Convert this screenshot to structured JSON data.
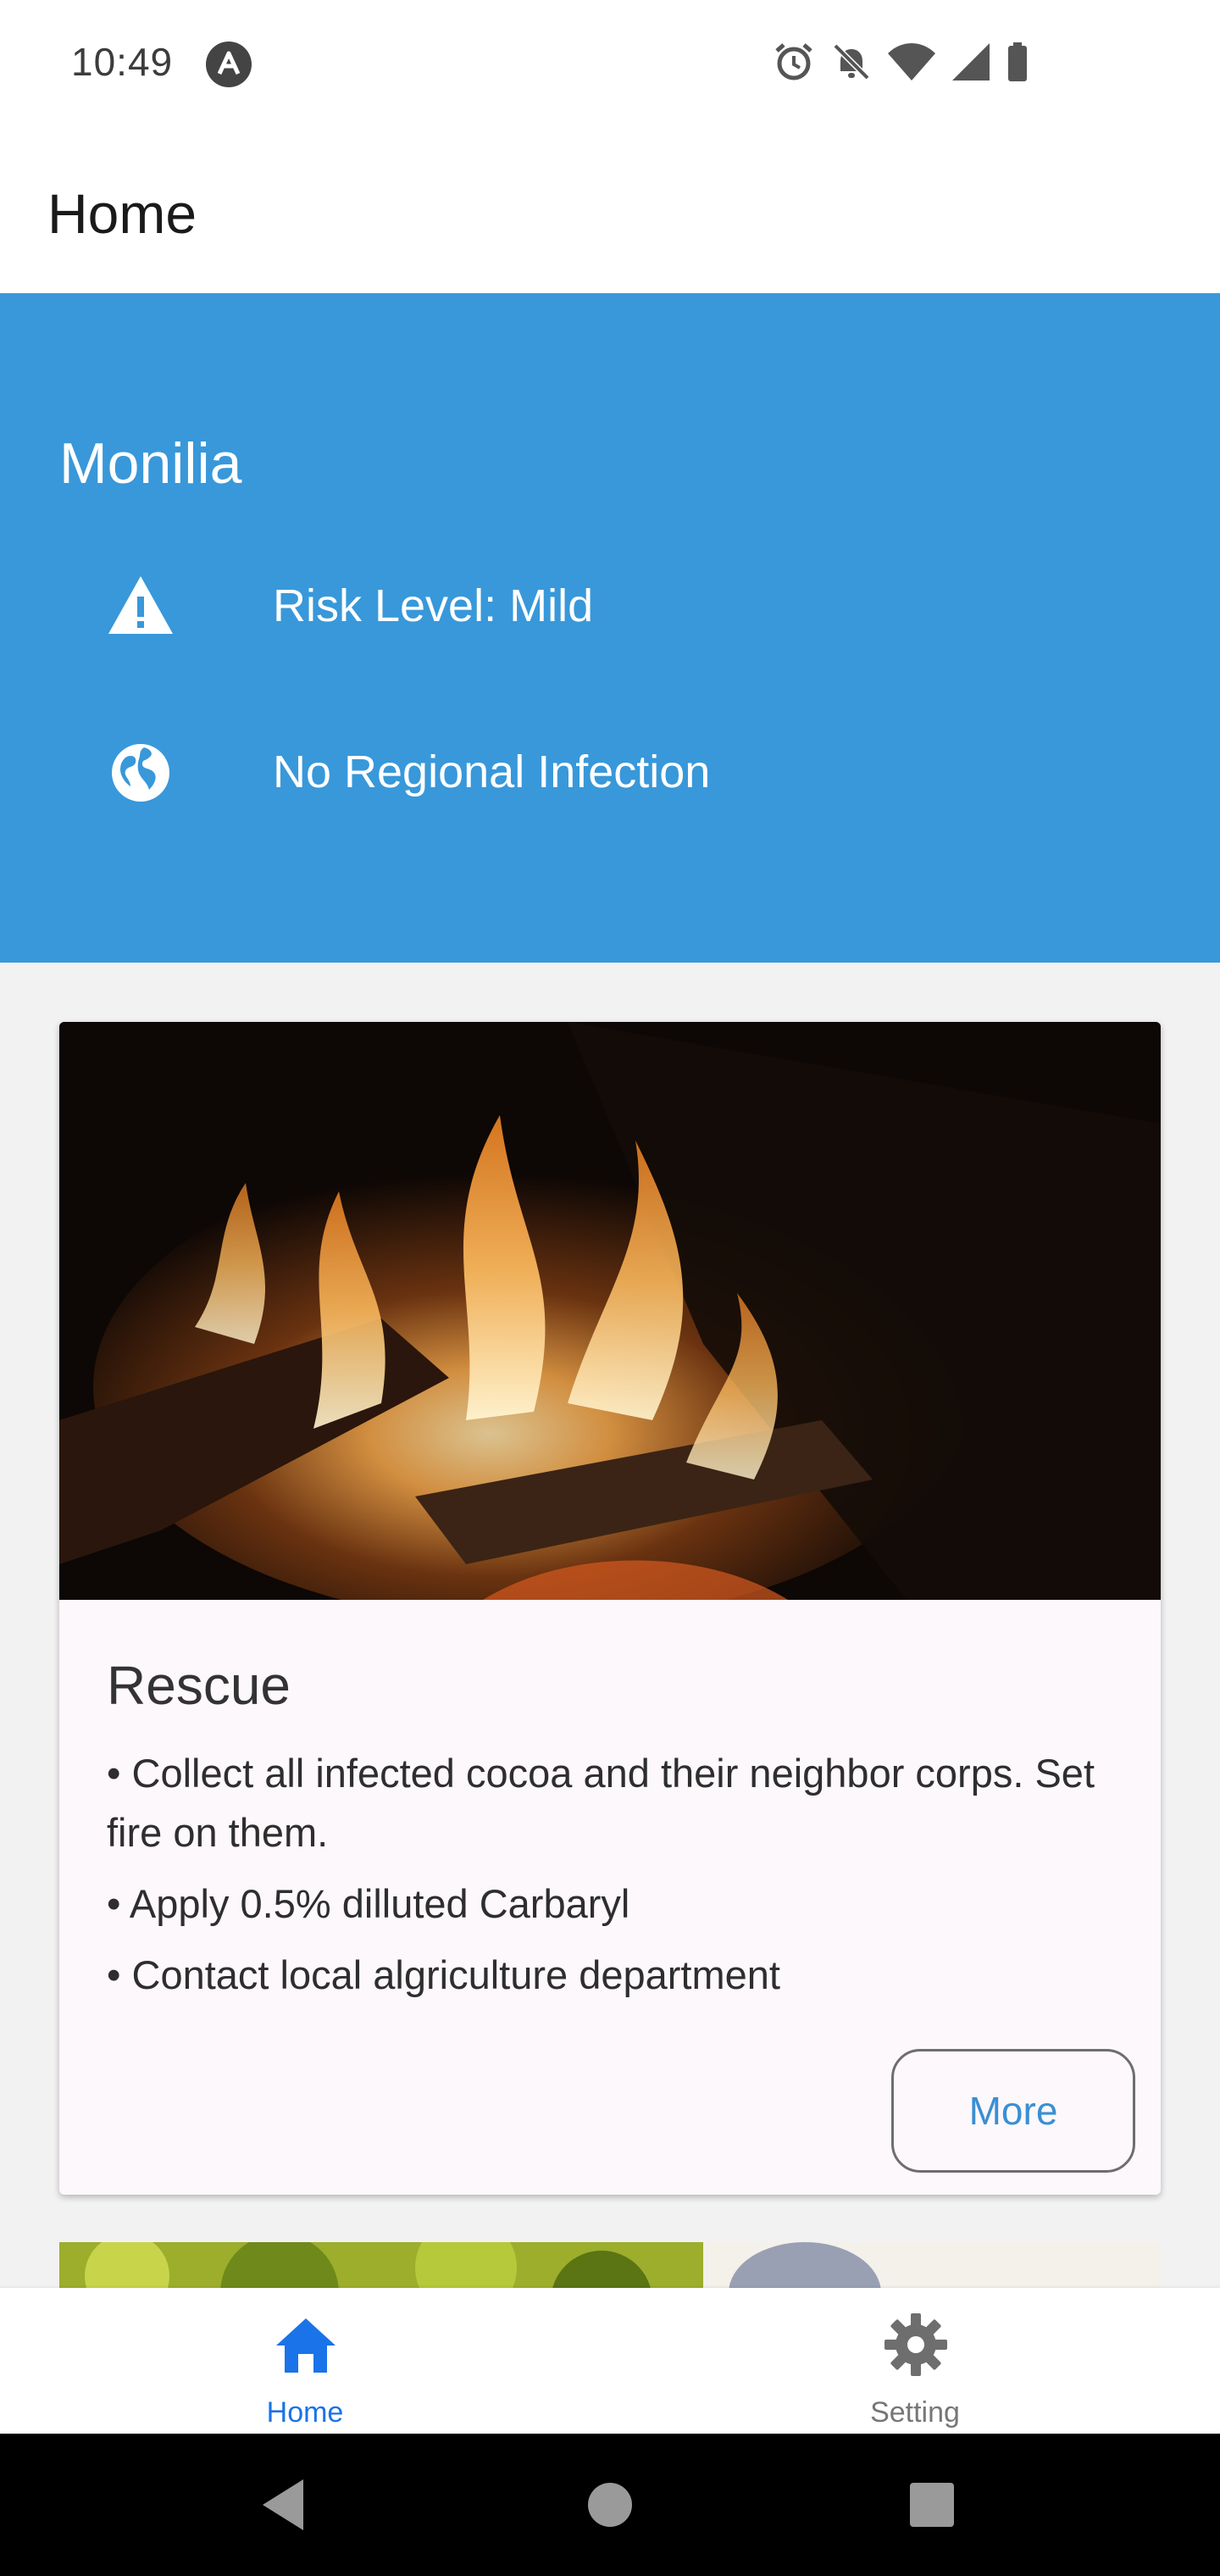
{
  "status_bar": {
    "time": "10:49",
    "icons": [
      "app-notification-icon",
      "alarm-icon",
      "bell-off-icon",
      "wifi-icon",
      "signal-icon",
      "battery-icon"
    ]
  },
  "app_bar": {
    "title": "Home"
  },
  "hero": {
    "title": "Monilia",
    "rows": [
      {
        "icon": "warning-icon",
        "label": "Risk Level: Mild"
      },
      {
        "icon": "globe-icon",
        "label": "No Regional Infection"
      }
    ],
    "background_color": "#3898da"
  },
  "card": {
    "image": "campfire-flames-image",
    "title": "Rescue",
    "bullets": [
      "• Collect all infected cocoa and their neighbor corps. Set fire on them.",
      "• Apply 0.5% dilluted Carbaryl",
      "• Contact local algriculture department"
    ],
    "more_label": "More"
  },
  "next_card": {
    "image": "garden-foliage-image"
  },
  "bottom_nav": {
    "items": [
      {
        "icon": "home-icon",
        "label": "Home",
        "active": true
      },
      {
        "icon": "gear-icon",
        "label": "Setting",
        "active": false
      }
    ],
    "active_color": "#1a73e8"
  },
  "system_nav": {
    "buttons": [
      "back-icon",
      "home-circle-icon",
      "recents-icon"
    ]
  }
}
